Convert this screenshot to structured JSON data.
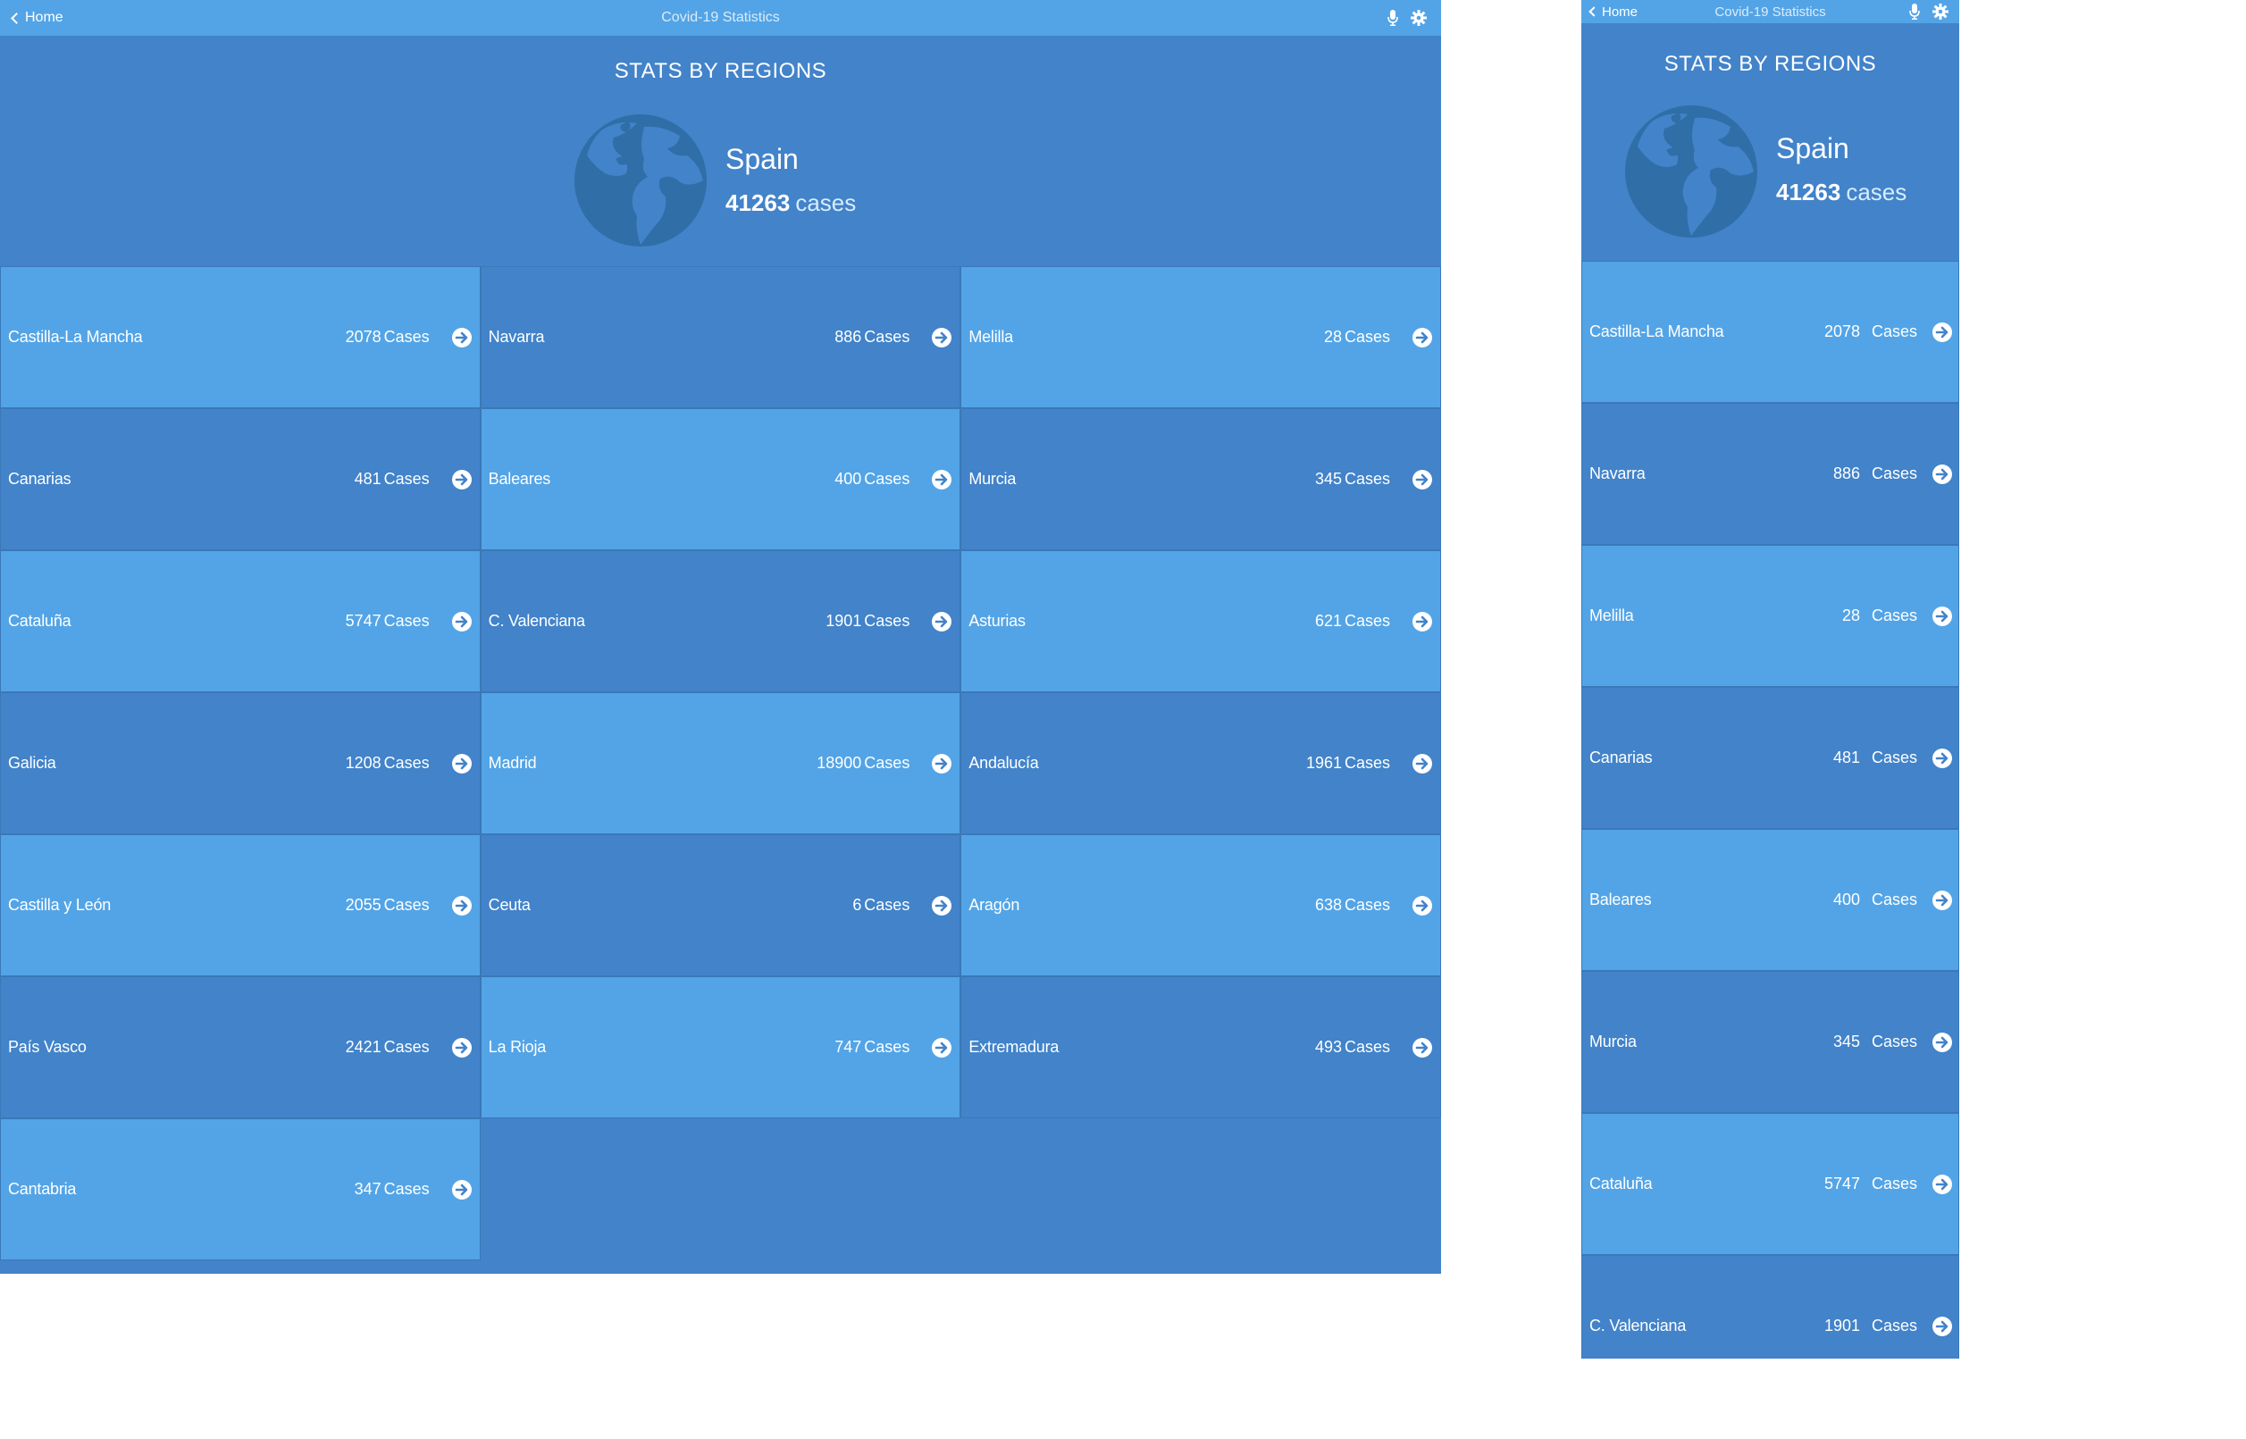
{
  "navbar": {
    "back_label": "Home",
    "title": "Covid-19 Statistics",
    "icons": [
      "microphone-icon",
      "gear-icon"
    ]
  },
  "header": {
    "title": "STATS BY REGIONS",
    "country": "Spain",
    "total_cases": "41263",
    "cases_unit": "cases",
    "icon": "globe-icon"
  },
  "cases_label": "Cases",
  "colors": {
    "light_tile": "#53A4E6",
    "dark_tile": "#4283CA",
    "navbar": "#53A4E6",
    "globe": "#2F6EA7"
  },
  "regions": [
    {
      "name": "Castilla-La Mancha",
      "count": "2078"
    },
    {
      "name": "Navarra",
      "count": "886"
    },
    {
      "name": "Melilla",
      "count": "28"
    },
    {
      "name": "Canarias",
      "count": "481"
    },
    {
      "name": "Baleares",
      "count": "400"
    },
    {
      "name": "Murcia",
      "count": "345"
    },
    {
      "name": "Cataluña",
      "count": "5747"
    },
    {
      "name": "C. Valenciana",
      "count": "1901"
    },
    {
      "name": "Asturias",
      "count": "621"
    },
    {
      "name": "Galicia",
      "count": "1208"
    },
    {
      "name": "Madrid",
      "count": "18900"
    },
    {
      "name": "Andalucía",
      "count": "1961"
    },
    {
      "name": "Castilla y León",
      "count": "2055"
    },
    {
      "name": "Ceuta",
      "count": "6"
    },
    {
      "name": "Aragón",
      "count": "638"
    },
    {
      "name": "País Vasco",
      "count": "2421"
    },
    {
      "name": "La Rioja",
      "count": "747"
    },
    {
      "name": "Extremadura",
      "count": "493"
    },
    {
      "name": "Cantabria",
      "count": "347"
    }
  ],
  "phone_regions": [
    {
      "name": "Castilla-La Mancha",
      "count": "2078"
    },
    {
      "name": "Navarra",
      "count": "886"
    },
    {
      "name": "Melilla",
      "count": "28"
    },
    {
      "name": "Canarias",
      "count": "481"
    },
    {
      "name": "Baleares",
      "count": "400"
    },
    {
      "name": "Murcia",
      "count": "345"
    },
    {
      "name": "Cataluña",
      "count": "5747"
    },
    {
      "name": "C. Valenciana",
      "count": "1901"
    }
  ]
}
